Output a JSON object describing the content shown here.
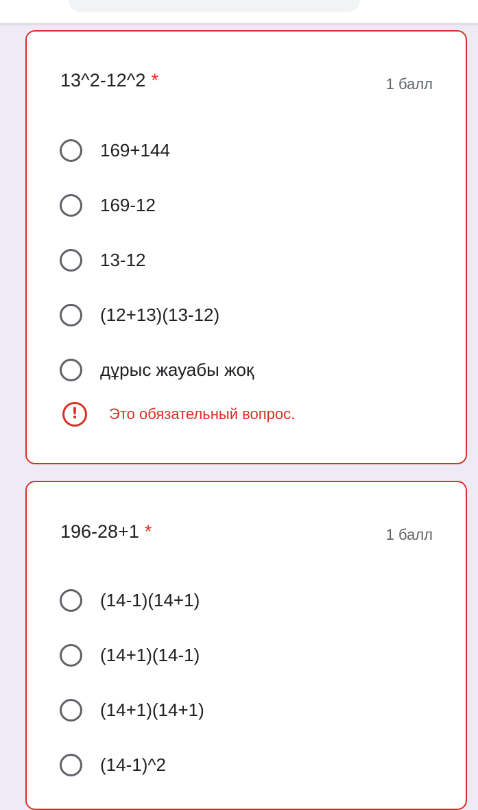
{
  "colors": {
    "error": "#d93025",
    "page_background": "#efebf6",
    "card_background": "#ffffff",
    "text": "#202124",
    "secondary_text": "#5f6368"
  },
  "questions": [
    {
      "title": "13^2-12^2",
      "required_mark": "*",
      "points": "1 балл",
      "options": [
        "169+144",
        "169-12",
        "13-12",
        "(12+13)(13-12)",
        "дұрыс жауабы жоқ"
      ],
      "error": {
        "icon": "exclamation-circle-icon",
        "icon_glyph": "!",
        "message": "Это обязательный вопрос."
      }
    },
    {
      "title": "196-28+1",
      "required_mark": "*",
      "points": "1 балл",
      "options": [
        "(14-1)(14+1)",
        "(14+1)(14-1)",
        "(14+1)(14+1)",
        "(14-1)^2"
      ]
    }
  ]
}
